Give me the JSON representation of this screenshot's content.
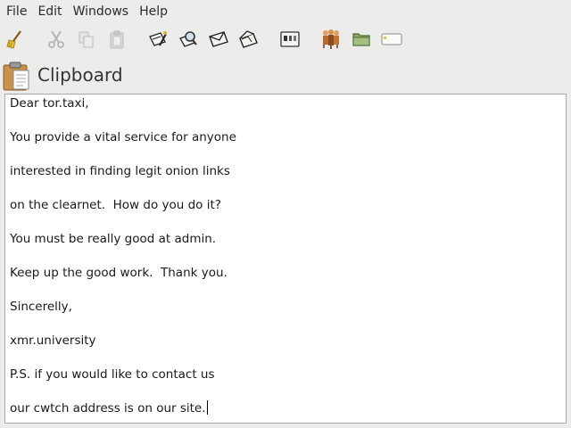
{
  "menubar": {
    "items": [
      "File",
      "Edit",
      "Windows",
      "Help"
    ]
  },
  "toolbar": {
    "buttons": [
      {
        "icon": "broom-clear-icon",
        "enabled": true
      },
      {
        "icon": "scissors-cut-icon",
        "enabled": false
      },
      {
        "icon": "copy-icon",
        "enabled": false
      },
      {
        "icon": "paste-icon",
        "enabled": false
      },
      {
        "icon": "sign-icon",
        "enabled": true
      },
      {
        "icon": "verify-icon",
        "enabled": true
      },
      {
        "icon": "encrypt-envelope-icon",
        "enabled": true
      },
      {
        "icon": "decrypt-envelope-icon",
        "enabled": true
      },
      {
        "icon": "smartcard-icon",
        "enabled": true
      },
      {
        "icon": "key-manager-people-icon",
        "enabled": true
      },
      {
        "icon": "folder-icon",
        "enabled": true
      },
      {
        "icon": "notepad-icon",
        "enabled": true
      }
    ]
  },
  "page": {
    "title": "Clipboard",
    "title_icon": "clipboard-icon"
  },
  "editor": {
    "lines": [
      "Dear tor.taxi,",
      "You provide a vital service for anyone",
      "interested in finding legit onion links",
      "on the clearnet.  How do you do it?",
      "You must be really good at admin.",
      "Keep up the good work.  Thank you.",
      "Sincerelly,",
      "xmr.university",
      "P.S. if you would like to contact us",
      "our cwtch address is on our site."
    ]
  },
  "colors": {
    "background": "#ececea",
    "editor_bg": "#ffffff",
    "text": "#1a1a1a"
  }
}
